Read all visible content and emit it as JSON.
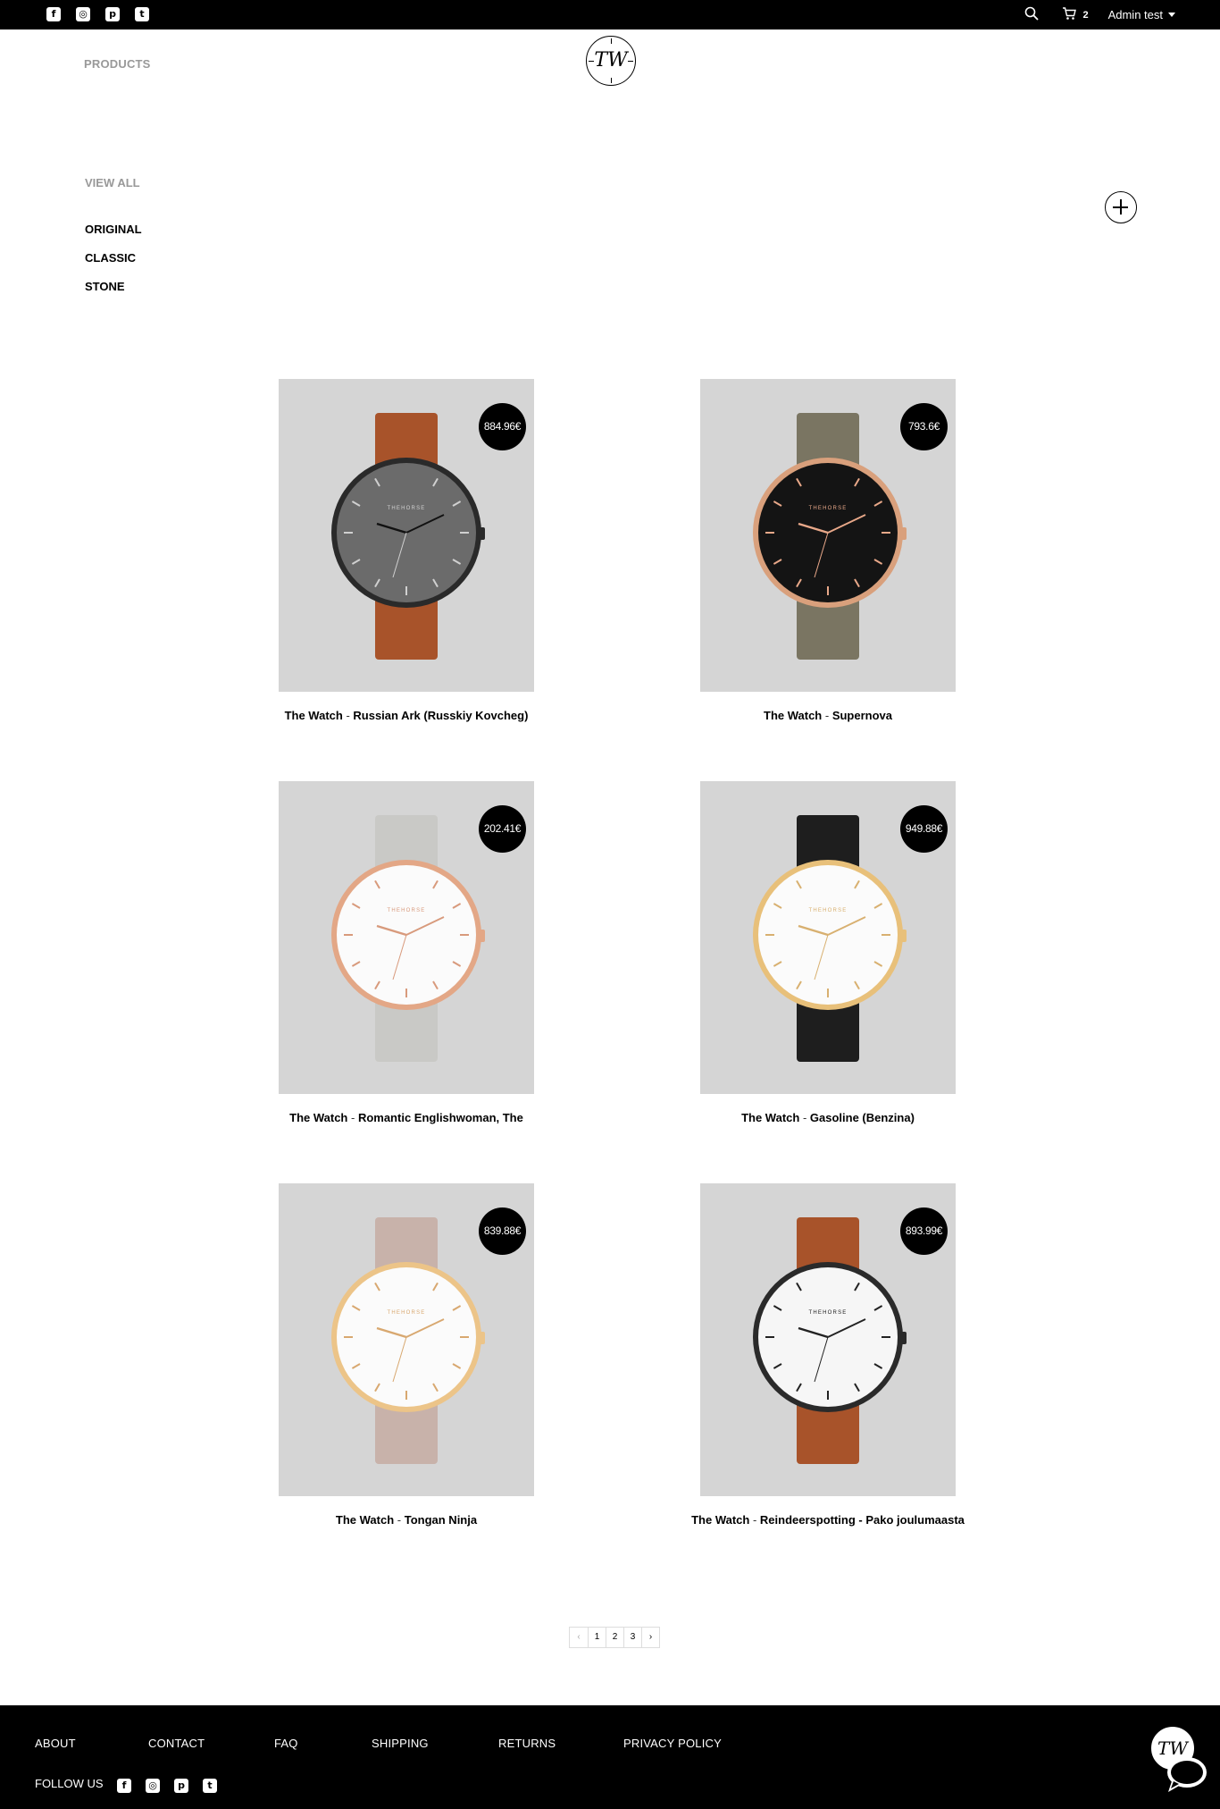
{
  "topbar": {
    "social_icons": [
      "facebook-icon",
      "instagram-icon",
      "pinterest-icon",
      "twitter-icon"
    ],
    "cart_count": "2",
    "user_name": "Admin test"
  },
  "header": {
    "products_label": "PRODUCTS",
    "logo_text": "TW"
  },
  "categories": {
    "view_all": "VIEW ALL",
    "items": [
      "ORIGINAL",
      "CLASSIC",
      "STONE"
    ]
  },
  "products": [
    {
      "brand": "The Watch",
      "name": "Russian Ark (Russkiy Kovcheg)",
      "price": "884.96€"
    },
    {
      "brand": "The Watch",
      "name": "Supernova",
      "price": "793.6€"
    },
    {
      "brand": "The Watch",
      "name": "Romantic Englishwoman, The",
      "price": "202.41€"
    },
    {
      "brand": "The Watch",
      "name": "Gasoline (Benzina)",
      "price": "949.88€"
    },
    {
      "brand": "The Watch",
      "name": "Tongan Ninja",
      "price": "839.88€"
    },
    {
      "brand": "The Watch",
      "name": "Reindeerspotting - Pako joulumaasta",
      "price": "893.99€"
    }
  ],
  "separator": " - ",
  "watch_brand_text": "THEHORSE",
  "pagination": {
    "prev": "‹",
    "pages": [
      "1",
      "2",
      "3"
    ],
    "next": "›"
  },
  "footer": {
    "links": [
      "ABOUT",
      "CONTACT",
      "FAQ",
      "SHIPPING",
      "RETURNS",
      "PRIVACY POLICY"
    ],
    "follow_label": "FOLLOW US",
    "social_icons": [
      "facebook-icon",
      "instagram-icon",
      "pinterest-icon",
      "twitter-icon"
    ]
  },
  "colors": {
    "topbar_bg": "#000000",
    "footer_bg": "#000000",
    "muted_text": "#999999",
    "card_bg": "#d5d5d5",
    "price_badge_bg": "#000000"
  }
}
